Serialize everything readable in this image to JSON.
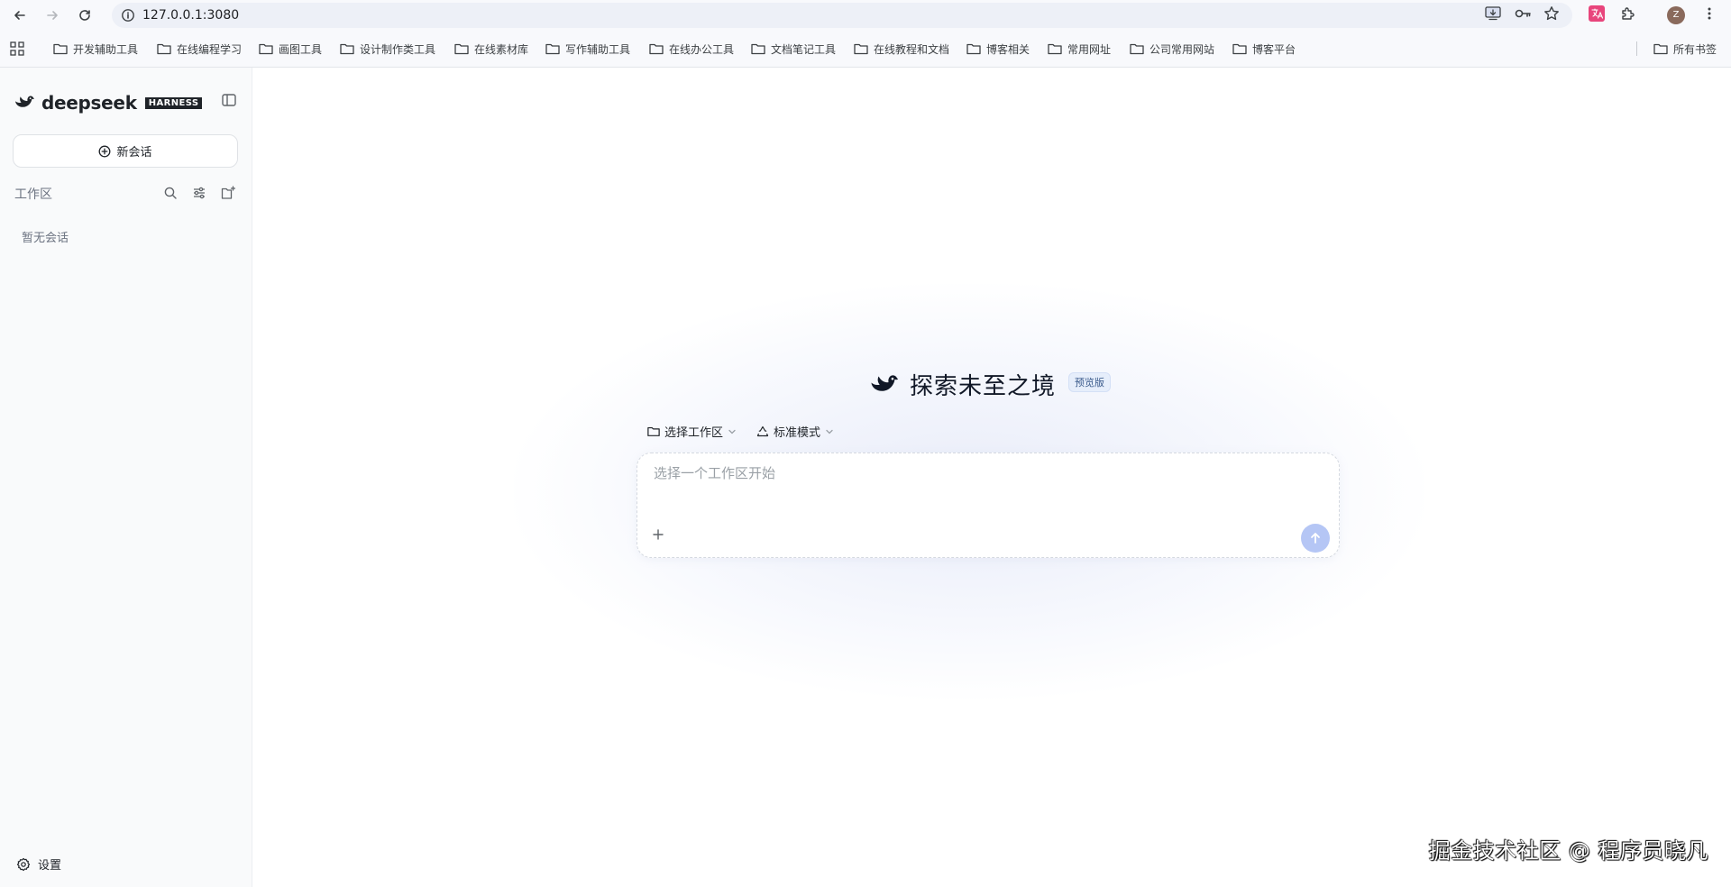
{
  "browser": {
    "url": "127.0.0.1:3080",
    "avatar_initial": "Z",
    "bookmarks": [
      {
        "label": "开发辅助工具"
      },
      {
        "label": "在线编程学习"
      },
      {
        "label": "画图工具"
      },
      {
        "label": "设计制作类工具"
      },
      {
        "label": "在线素材库"
      },
      {
        "label": "写作辅助工具"
      },
      {
        "label": "在线办公工具"
      },
      {
        "label": "文档笔记工具"
      },
      {
        "label": "在线教程和文档"
      },
      {
        "label": "博客相关"
      },
      {
        "label": "常用网址"
      },
      {
        "label": "公司常用网站"
      },
      {
        "label": "博客平台"
      }
    ],
    "all_bookmarks_label": "所有书签"
  },
  "sidebar": {
    "brand_name": "deepseek",
    "brand_badge": "HARNESS",
    "new_chat_label": "新会话",
    "workspace_label": "工作区",
    "empty_hint": "暂无会话",
    "settings_label": "设置"
  },
  "main": {
    "hero_title": "探索未至之境",
    "hero_badge": "预览版",
    "workspace_selector_label": "选择工作区",
    "mode_selector_label": "标准模式",
    "composer_placeholder": "选择一个工作区开始"
  },
  "watermark": "掘金技术社区 @ 程序员晓凡",
  "colors": {
    "accent": "#b5c6f5",
    "brand_dark": "#1f2328",
    "badge_bg": "#e6eefb"
  }
}
